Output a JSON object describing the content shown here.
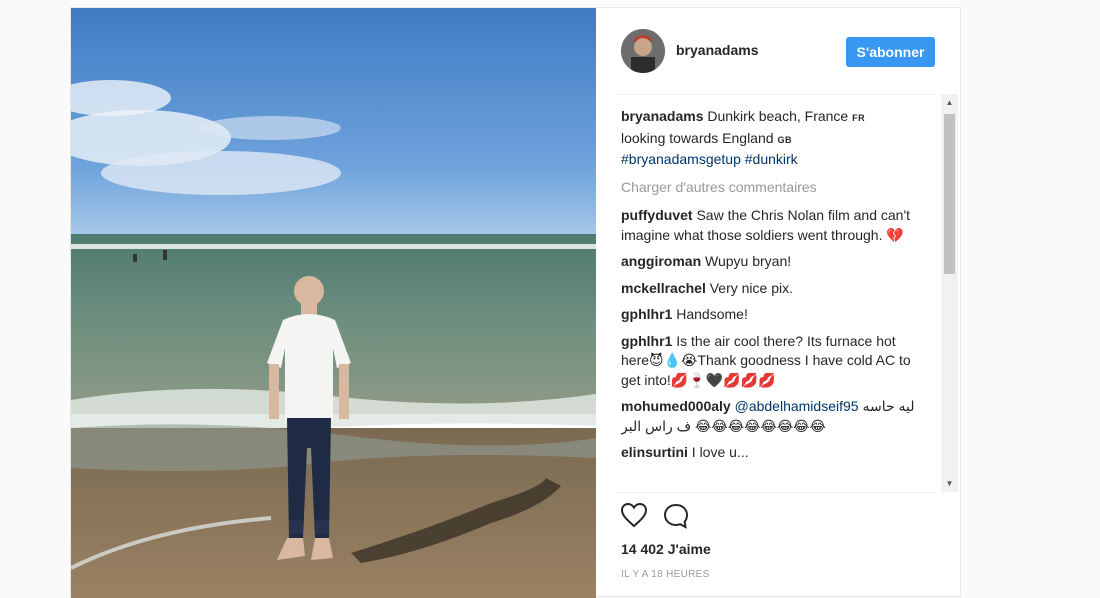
{
  "post": {
    "username": "bryanadams",
    "follow_label": "S'abonner",
    "caption": {
      "user": "bryanadams",
      "line1": "Dunkirk beach, France",
      "flag1": "FR",
      "line2": "looking towards England",
      "flag2": "GB",
      "hashtags": "#bryanadamsgetup #dunkirk"
    },
    "load_more": "Charger d'autres commentaires",
    "comments": [
      {
        "user": "puffyduvet",
        "text": "Saw the Chris Nolan film and can't imagine what those soldiers went through. 💔"
      },
      {
        "user": "anggiroman",
        "text": "Wupyu bryan!"
      },
      {
        "user": "mckellrachel",
        "text": "Very nice pix."
      },
      {
        "user": "gphlhr1",
        "text": "Handsome!"
      },
      {
        "user": "gphlhr1",
        "text": "Is the air cool there? Its furnace hot here😈💧😭Thank goodness I have cold AC to get into!💋🍷🖤💋💋💋"
      },
      {
        "user": "mohumed000aly",
        "mention": "@abdelhamidseif95",
        "text": "ليه حاسه ف راس البر 😂😂😂😂😂😂😂😂"
      },
      {
        "user": "elinsurtini",
        "text": "I love u..."
      }
    ],
    "likes": "14 402 J'aime",
    "timestamp": "IL Y A 18 HEURES"
  },
  "icons": {
    "like": "heart-icon",
    "comment": "speech-bubble-icon",
    "scroll_up": "arrow-up-icon",
    "scroll_down": "arrow-down-icon"
  },
  "colors": {
    "accent": "#3897f0",
    "text": "#262626",
    "muted": "#999999",
    "hashtag": "#003569"
  }
}
